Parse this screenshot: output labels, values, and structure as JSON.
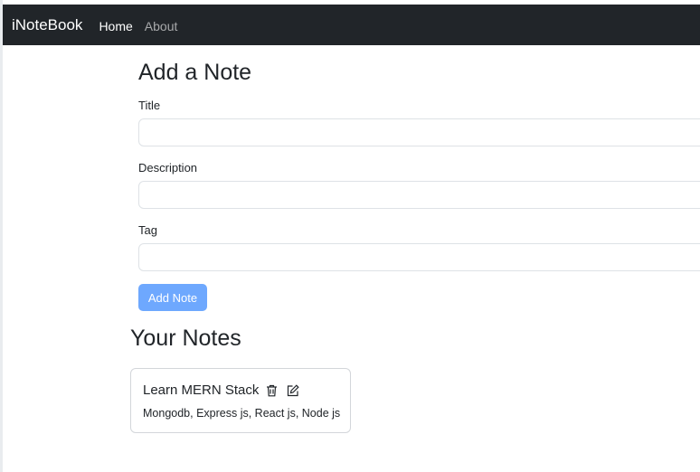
{
  "navbar": {
    "brand": "iNoteBook",
    "links": [
      {
        "label": "Home"
      },
      {
        "label": "About"
      }
    ]
  },
  "form": {
    "heading": "Add a Note",
    "fields": {
      "title": {
        "label": "Title",
        "value": "",
        "placeholder": ""
      },
      "description": {
        "label": "Description",
        "value": "",
        "placeholder": ""
      },
      "tag": {
        "label": "Tag",
        "value": "",
        "placeholder": ""
      }
    },
    "submit_label": "Add Note"
  },
  "notes": {
    "heading": "Your Notes",
    "items": [
      {
        "title": "Learn MERN Stack",
        "description": "Mongodb, Express js, React js, Node js"
      }
    ]
  },
  "colors": {
    "navbar_bg": "#212529",
    "button_bg": "#6ea8fe",
    "text": "#212529"
  },
  "icons": {
    "delete": "trash-icon",
    "edit": "edit-icon"
  }
}
